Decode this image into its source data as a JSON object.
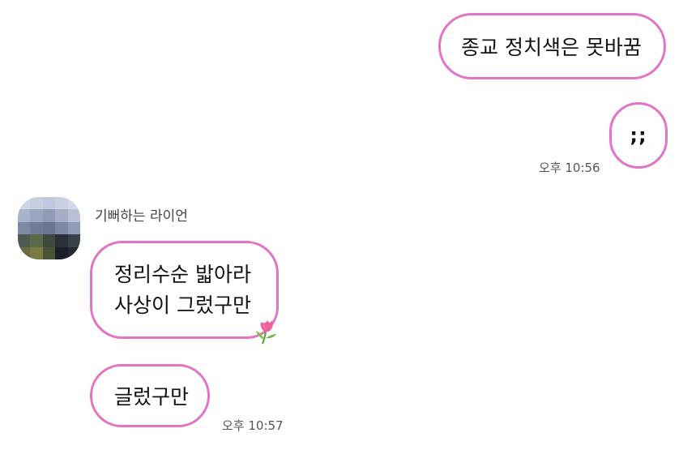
{
  "theme": {
    "bubble_border": "#e274c6",
    "background": "#ffffff"
  },
  "outgoing": {
    "messages": [
      {
        "text": "종교 정치색은 못바꿈"
      },
      {
        "text": ";;"
      }
    ],
    "timestamp": "오후 10:56"
  },
  "incoming": {
    "sender_name": "기뻐하는 라이언",
    "avatar_icon": "pixelated-profile-avatar",
    "messages": [
      {
        "lines": [
          "정리수순 밟아라",
          "사상이 그렀구만"
        ],
        "reaction_icon": "tulip-icon"
      },
      {
        "text": "글렀구만"
      }
    ],
    "timestamp": "오후 10:57"
  }
}
